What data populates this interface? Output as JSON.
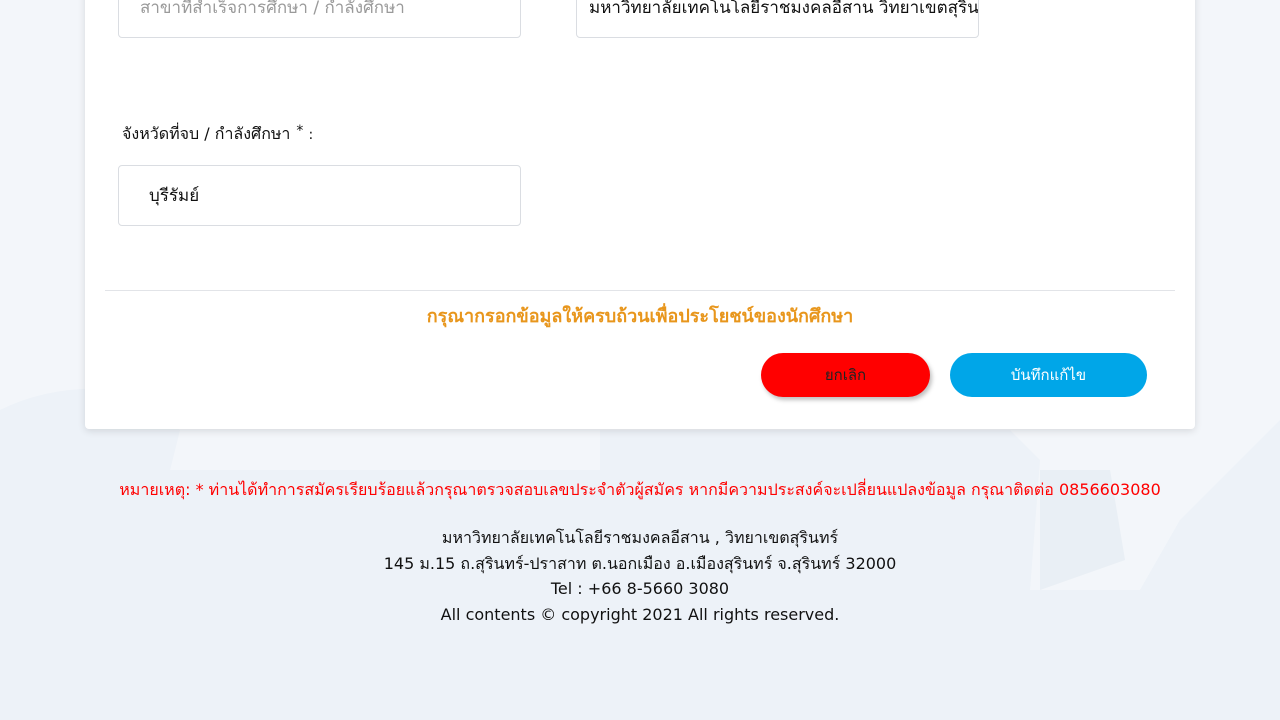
{
  "form": {
    "major_field": {
      "placeholder": "สาขาที่สำเร็จการศึกษา  / กำลังศึกษา"
    },
    "university_field": {
      "value": "มหาวิทยาลัยเทคโนโลยีราชมงคลอีสาน วิทยาเขตสุรินทร์"
    },
    "province_label": "จังหวัดที่จบ / กำลังศึกษา",
    "required_mark": "*",
    "label_colon": ":",
    "province_field": {
      "value": "บุรีรัมย์"
    },
    "notice": "กรุณากรอกข้อมูลให้ครบถ้วนเพื่อประโยชน์ของนักศึกษา",
    "cancel_label": "ยกเลิก",
    "save_label": "บันทึกแก้ไข"
  },
  "remark": "หมายเหตุ:  *  ท่านได้ทำการสมัครเรียบร้อยแล้วกรุณาตรวจสอบเลขประจำตัวผู้สมัคร หากมีความประสงค์จะเปลี่ยนแปลงข้อมูล กรุณาติดต่อ 0856603080",
  "footer": {
    "institution": "มหาวิทยาลัยเทคโนโลยีราชมงคลอีสาน , วิทยาเขตสุรินทร์",
    "address": "145 ม.15 ถ.สุรินทร์-ปราสาท ต.นอกเมือง อ.เมืองสุรินทร์ จ.สุรินทร์ 32000",
    "tel": "Tel : +66 8-5660 3080",
    "copyright": "All contents © copyright 2021 All rights reserved."
  },
  "colors": {
    "cancel": "#ff0000",
    "save": "#00a6e8",
    "notice": "#e8961c",
    "remark": "#ff0000"
  }
}
